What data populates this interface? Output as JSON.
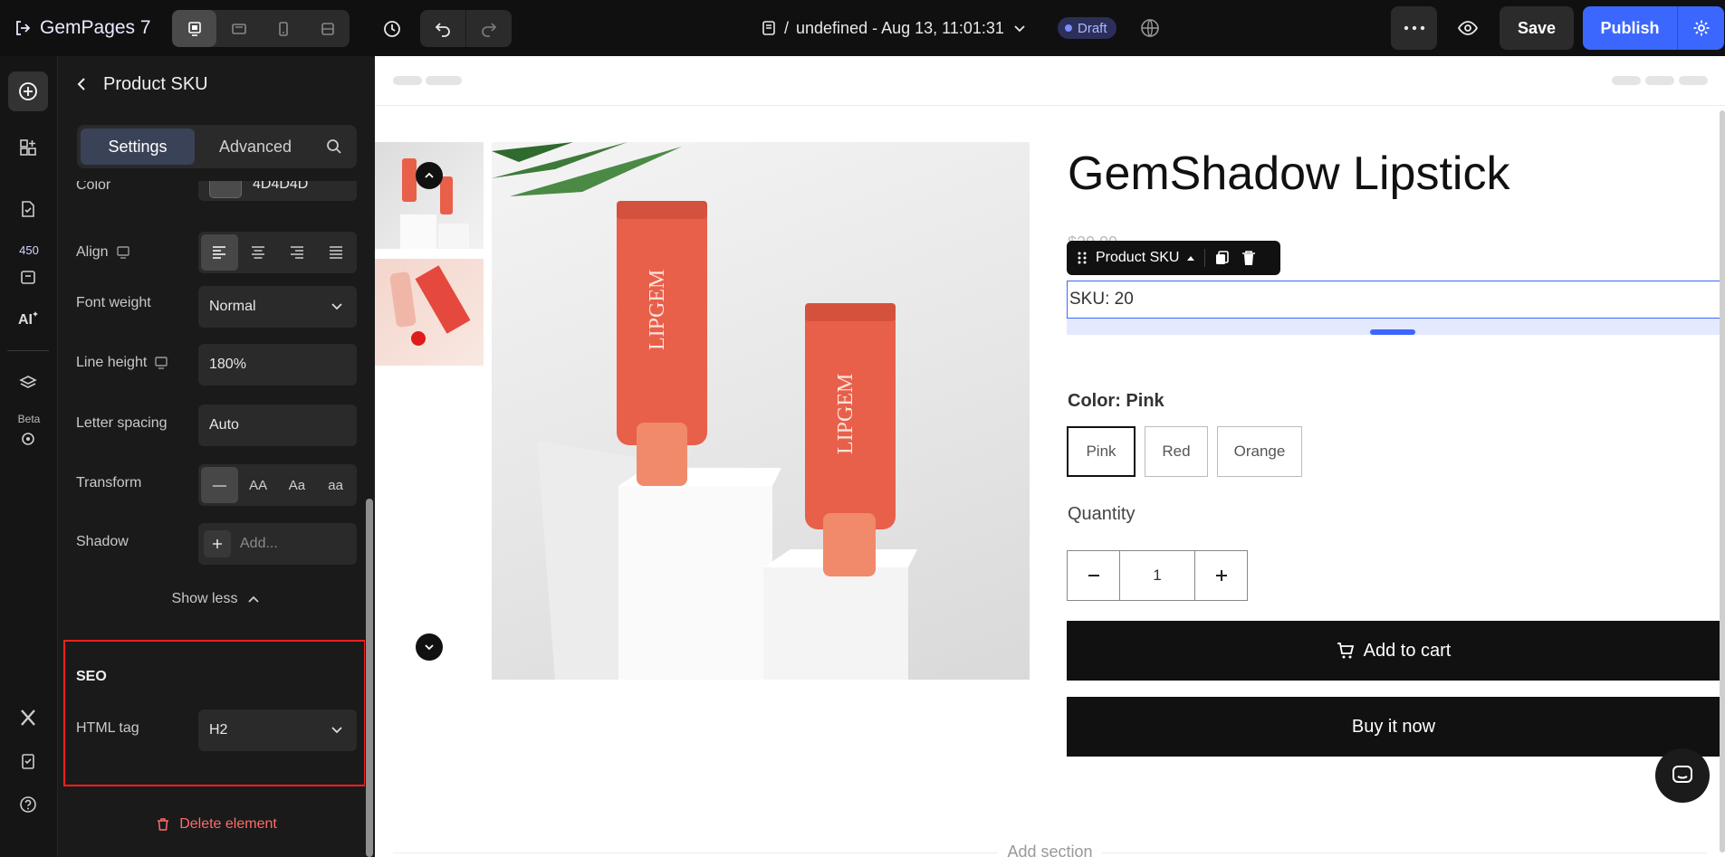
{
  "topbar": {
    "logo_text": "GemPages 7",
    "page_path_prefix": "/",
    "page_name": "undefined - Aug 13, 11:01:31",
    "status_badge": "Draft",
    "save_label": "Save",
    "publish_label": "Publish"
  },
  "rail": {
    "credits_badge": "450",
    "beta_badge": "Beta"
  },
  "panel": {
    "title": "Product SKU",
    "tabs": {
      "settings": "Settings",
      "advanced": "Advanced"
    },
    "color_label": "Color",
    "color_value": "4D4D4D",
    "align_label": "Align",
    "font_weight_label": "Font weight",
    "font_weight_value": "Normal",
    "line_height_label": "Line height",
    "line_height_value": "180%",
    "letter_spacing_label": "Letter spacing",
    "letter_spacing_value": "Auto",
    "transform_label": "Transform",
    "transform_options": [
      "—",
      "AA",
      "Aa",
      "aa"
    ],
    "shadow_label": "Shadow",
    "shadow_placeholder": "Add...",
    "show_less": "Show less",
    "seo_title": "SEO",
    "html_tag_label": "HTML tag",
    "html_tag_value": "H2",
    "delete_element": "Delete element"
  },
  "canvas": {
    "product_title": "GemShadow Lipstick",
    "price_ghost": "$20.00",
    "sku_toolbar_label": "Product SKU",
    "sku_text": "SKU: 20",
    "color_label": "Color: Pink",
    "color_options": [
      "Pink",
      "Red",
      "Orange"
    ],
    "quantity_label": "Quantity",
    "quantity_value": "1",
    "add_to_cart": "Add to cart",
    "buy_now": "Buy it now",
    "add_section": "Add section"
  },
  "colors": {
    "accent": "#3c67ff",
    "highlight_box": "#ff1f1f",
    "delete": "#ff6b6b",
    "product_tube": "#e8604a"
  }
}
